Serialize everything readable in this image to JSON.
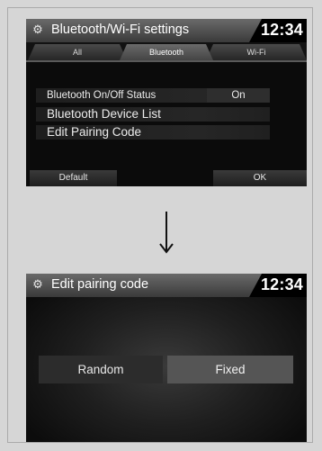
{
  "screen1": {
    "title": "Bluetooth/Wi-Fi settings",
    "clock": "12:34",
    "tabs": [
      {
        "label": "All"
      },
      {
        "label": "Bluetooth"
      },
      {
        "label": "Wi-Fi"
      }
    ],
    "rows": {
      "status_label": "Bluetooth On/Off Status",
      "status_value": "On",
      "device_list": "Bluetooth Device List",
      "edit_pairing": "Edit Pairing Code"
    },
    "default_label": "Default",
    "ok_label": "OK"
  },
  "screen2": {
    "title": "Edit pairing code",
    "clock": "12:34",
    "options": [
      {
        "label": "Random"
      },
      {
        "label": "Fixed"
      }
    ]
  },
  "icons": {
    "settings": "gear-icon",
    "transition": "down-arrow-icon"
  },
  "colors": {
    "background": "#d6d6d6",
    "screen": "#0b0b0b",
    "selected_option": "#555555"
  }
}
